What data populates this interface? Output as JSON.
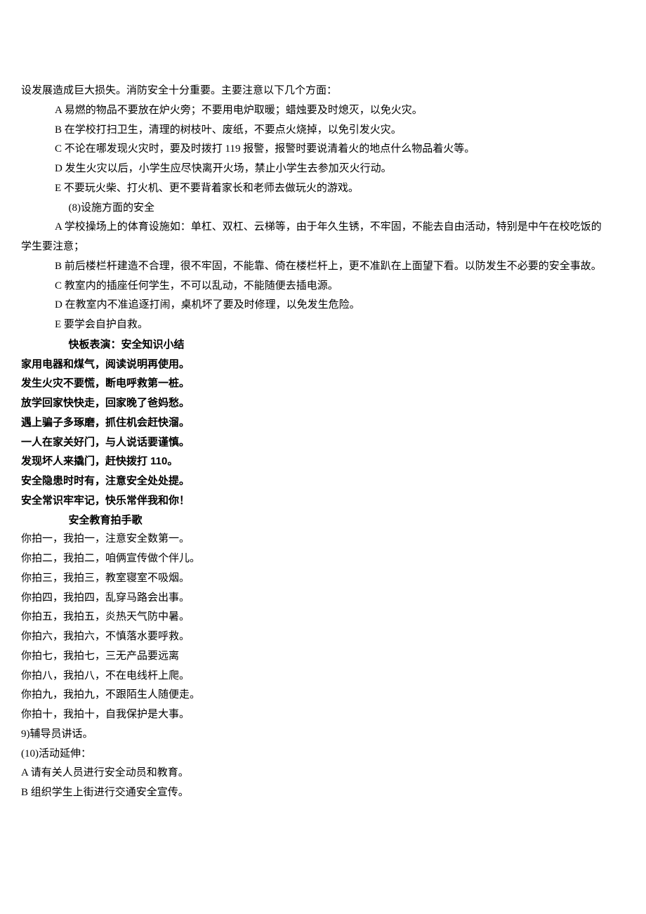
{
  "lines": [
    {
      "cls": "para noindent",
      "text": "设发展造成巨大损失。消防安全十分重要。主要注意以下几个方面："
    },
    {
      "cls": "para indent1",
      "text": "A 易燃的物品不要放在炉火旁；不要用电炉取暖；蜡烛要及时熄灭，以免火灾。"
    },
    {
      "cls": "para indent1",
      "text": "B 在学校打扫卫生，清理的树枝叶、废纸，不要点火烧掉，以免引发火灾。"
    },
    {
      "cls": "para indent1",
      "text": "C 不论在哪发现火灾时，要及时拨打 119 报警，报警时要说清着火的地点什么物品着火等。"
    },
    {
      "cls": "para indent1",
      "text": "D 发生火灾以后，小学生应尽快离开火场，禁止小学生去参加灭火行动。"
    },
    {
      "cls": "para indent1",
      "text": "E 不要玩火柴、打火机、更不要背着家长和老师去做玩火的游戏。"
    },
    {
      "cls": "para indent2",
      "text": "(8)设施方面的安全"
    },
    {
      "cls": "para indent1",
      "text": "A 学校操场上的体育设施如：单杠、双杠、云梯等，由于年久生锈，不牢固，不能去自由活动，特别是中午在校吃饭的"
    },
    {
      "cls": "para noindent",
      "text": "学生要注意；"
    },
    {
      "cls": "para indent1",
      "text": "B 前后楼栏杆建造不合理，很不牢固，不能靠、倚在楼栏杆上，更不准趴在上面望下看。以防发生不必要的安全事故。"
    },
    {
      "cls": "para indent1",
      "text": "C 教室内的插座任何学生，不可以乱动，不能随便去插电源。"
    },
    {
      "cls": "para indent1",
      "text": "D 在教室内不准追逐打闹，桌机坏了要及时修理，以免发生危险。"
    },
    {
      "cls": "para indent1",
      "text": "E 要学会自护自救。"
    },
    {
      "cls": "para indent2 bold",
      "text": "快板表演：安全知识小结"
    },
    {
      "cls": "para noindent bold",
      "text": "家用电器和煤气，阅读说明再使用。"
    },
    {
      "cls": "para noindent bold",
      "text": "发生火灾不要慌，断电呼救第一桩。"
    },
    {
      "cls": "para noindent bold",
      "text": "放学回家快快走，回家晚了爸妈愁。"
    },
    {
      "cls": "para noindent bold",
      "text": "遇上骗子多琢磨，抓住机会赶快溜。"
    },
    {
      "cls": "para noindent bold",
      "text": "一人在家关好门，与人说话要谨慎。"
    },
    {
      "cls": "para noindent bold",
      "text": "发现坏人来撬门，赶快拨打 110。"
    },
    {
      "cls": "para noindent bold",
      "text": "安全隐患时时有，注意安全处处提。"
    },
    {
      "cls": "para noindent bold",
      "text": "安全常识牢牢记，快乐常伴我和你！"
    },
    {
      "cls": "para indent2 bold",
      "text": "安全教育拍手歌"
    },
    {
      "cls": "para noindent",
      "text": "你拍一，我拍一，注意安全数第一。"
    },
    {
      "cls": "para noindent",
      "text": "你拍二，我拍二，咱俩宣传做个伴儿。"
    },
    {
      "cls": "para noindent",
      "text": "你拍三，我拍三，教室寝室不吸烟。"
    },
    {
      "cls": "para noindent",
      "text": "你拍四，我拍四，乱穿马路会出事。"
    },
    {
      "cls": "para noindent",
      "text": "你拍五，我拍五，炎热天气防中暑。"
    },
    {
      "cls": "para noindent",
      "text": "你拍六，我拍六，不慎落水要呼救。"
    },
    {
      "cls": "para noindent",
      "text": "你拍七，我拍七，三无产品要远离"
    },
    {
      "cls": "para noindent",
      "text": "你拍八，我拍八，不在电线杆上爬。"
    },
    {
      "cls": "para noindent",
      "text": "你拍九，我拍九，不跟陌生人随便走。"
    },
    {
      "cls": "para noindent",
      "text": "你拍十，我拍十，自我保护是大事。"
    },
    {
      "cls": "para noindent",
      "text": "9)辅导员讲话。"
    },
    {
      "cls": "para noindent",
      "text": "(10)活动延伸："
    },
    {
      "cls": "para noindent",
      "text": "A 请有关人员进行安全动员和教育。"
    },
    {
      "cls": "para noindent",
      "text": "B 组织学生上街进行交通安全宣传。"
    }
  ]
}
